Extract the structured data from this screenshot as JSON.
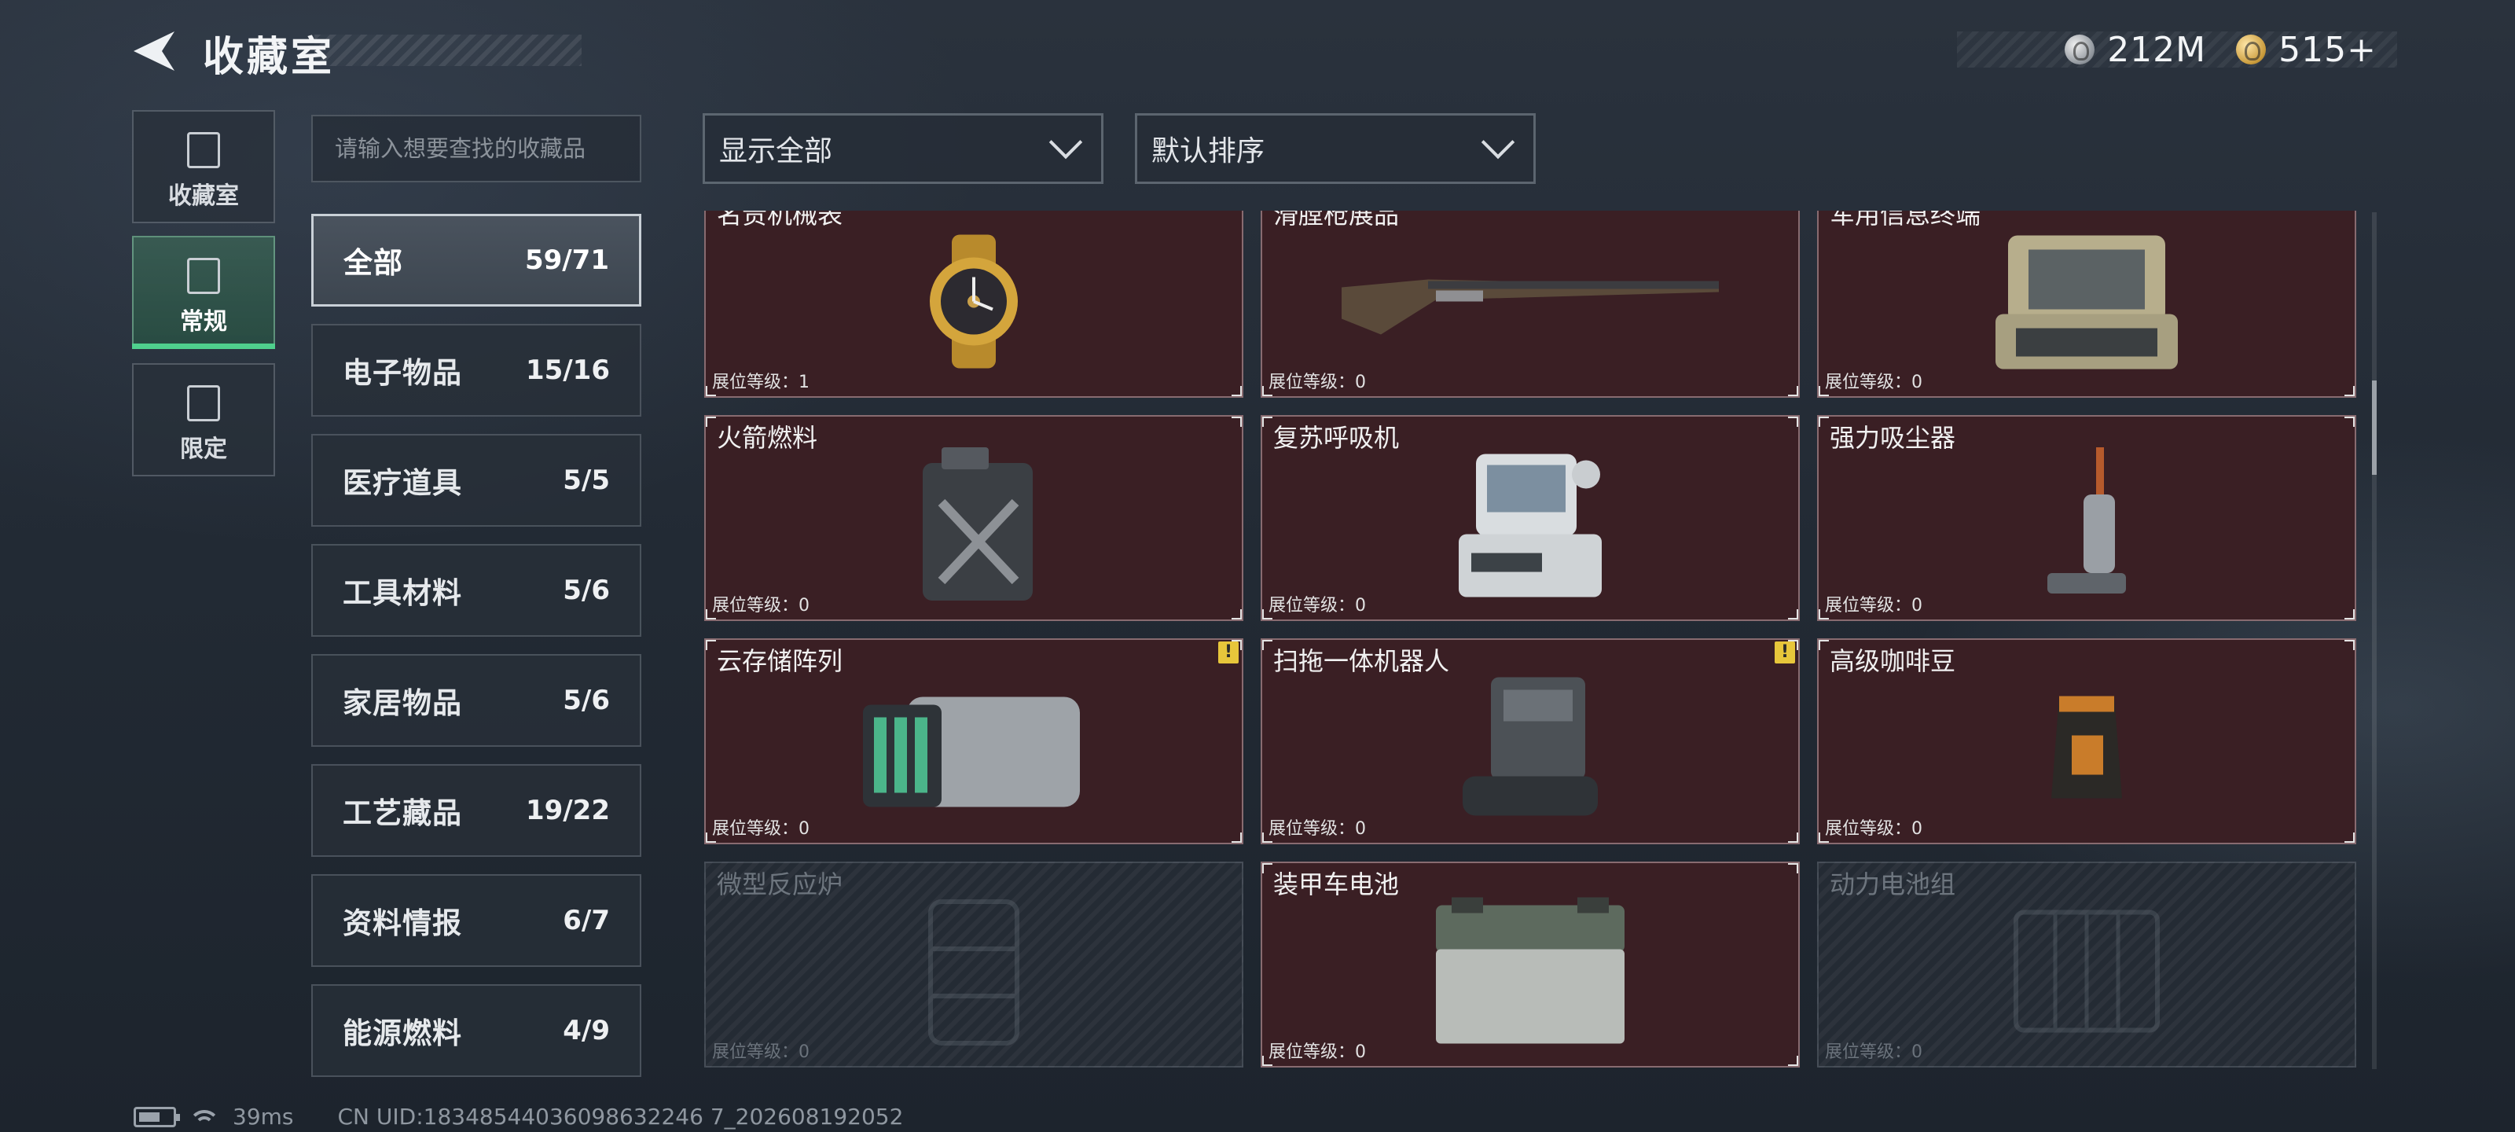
{
  "header": {
    "title": "收藏室",
    "currencies": [
      {
        "icon": "silver-coin-icon",
        "value": "212M"
      },
      {
        "icon": "gold-coin-icon",
        "value": "515+"
      }
    ]
  },
  "side_tabs": [
    {
      "label": "收藏室",
      "icon": "trophy-icon",
      "active": false
    },
    {
      "label": "常规",
      "icon": "regular-icon",
      "active": true
    },
    {
      "label": "限定",
      "icon": "limited-icon",
      "active": false
    }
  ],
  "search": {
    "placeholder": "请输入想要查找的收藏品"
  },
  "filters": {
    "display": "显示全部",
    "sort": "默认排序"
  },
  "categories": [
    {
      "name": "全部",
      "count": "59/71",
      "active": true
    },
    {
      "name": "电子物品",
      "count": "15/16"
    },
    {
      "name": "医疗道具",
      "count": "5/5"
    },
    {
      "name": "工具材料",
      "count": "5/6"
    },
    {
      "name": "家居物品",
      "count": "5/6"
    },
    {
      "name": "工艺藏品",
      "count": "19/22"
    },
    {
      "name": "资料情报",
      "count": "6/7"
    },
    {
      "name": "能源燃料",
      "count": "4/9"
    }
  ],
  "level_label": "展位等级：",
  "items": [
    {
      "name": "名贵机械表",
      "level": "1",
      "icon": "gold-watch-icon",
      "locked": false
    },
    {
      "name": "滑膛枪展品",
      "level": "0",
      "icon": "musket-icon",
      "locked": false
    },
    {
      "name": "军用信息终端",
      "level": "0",
      "icon": "rugged-terminal-icon",
      "locked": false
    },
    {
      "name": "火箭燃料",
      "level": "0",
      "icon": "fuel-canister-icon",
      "locked": false
    },
    {
      "name": "复苏呼吸机",
      "level": "0",
      "icon": "ventilator-icon",
      "locked": false
    },
    {
      "name": "强力吸尘器",
      "level": "0",
      "icon": "vacuum-cleaner-icon",
      "locked": false
    },
    {
      "name": "云存储阵列",
      "level": "0",
      "icon": "storage-array-icon",
      "locked": false,
      "warning": true
    },
    {
      "name": "扫拖一体机器人",
      "level": "0",
      "icon": "robot-vacuum-icon",
      "locked": false,
      "warning": true
    },
    {
      "name": "高级咖啡豆",
      "level": "0",
      "icon": "coffee-bag-icon",
      "locked": false
    },
    {
      "name": "微型反应炉",
      "level": "0",
      "icon": "reactor-icon",
      "locked": true
    },
    {
      "name": "装甲车电池",
      "level": "0",
      "icon": "car-battery-icon",
      "locked": false
    },
    {
      "name": "动力电池组",
      "level": "0",
      "icon": "battery-pack-icon",
      "locked": true
    }
  ],
  "footer": {
    "ping": "39ms",
    "uid": "CN UID:18348544036098632246 7_202608192052"
  }
}
